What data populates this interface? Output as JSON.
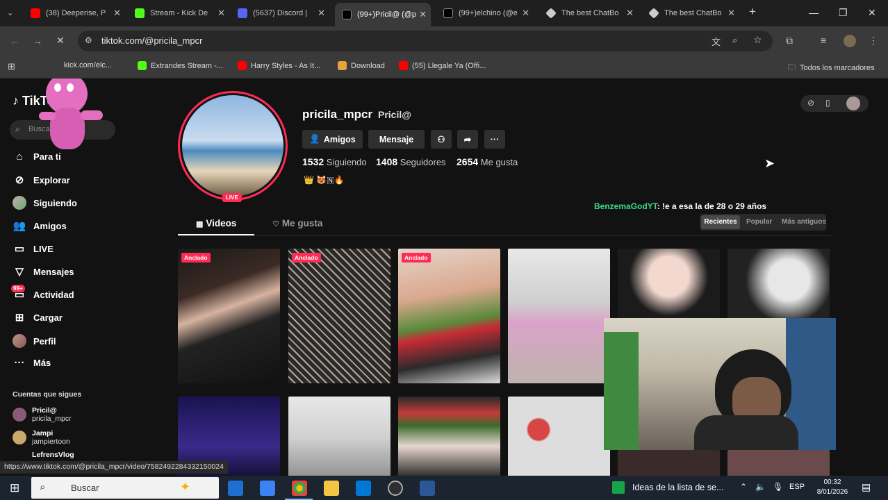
{
  "browser": {
    "tabs": [
      {
        "title": "(38) Deeperise, P",
        "color": "#ff0000"
      },
      {
        "title": "Stream - Kick De",
        "color": "#53fc18"
      },
      {
        "title": "(5637) Discord |",
        "color": "#5865f2"
      },
      {
        "title": "(99+)Pricil@ (@p",
        "color": "#000000"
      },
      {
        "title": "(99+)elchino (@e",
        "color": "#000000"
      },
      {
        "title": "The best ChatBo",
        "color": "#cccccc"
      },
      {
        "title": "The best ChatBo",
        "color": "#cccccc"
      }
    ],
    "new_tab_icon": "plus-icon",
    "url": "tiktok.com/@pricila_mpcr",
    "bookmarks": [
      {
        "label": "kick.com/elc...",
        "color": "#53fc18"
      },
      {
        "label": "Extrandes Stream -...",
        "color": "#53fc18"
      },
      {
        "label": "Harry Styles - As It...",
        "color": "#ff0000"
      },
      {
        "label": "Download",
        "color": "#e8a33d"
      },
      {
        "label": "(55) Llegale Ya (Offi...",
        "color": "#ff0000"
      }
    ],
    "all_bookmarks": "Todos los marcadores"
  },
  "sidebar": {
    "logo": "TikTok",
    "search_placeholder": "Buscar",
    "items": [
      {
        "label": "Para ti",
        "icon": "⌂"
      },
      {
        "label": "Explorar",
        "icon": "⊘"
      },
      {
        "label": "Siguiendo",
        "icon": "avatar"
      },
      {
        "label": "Amigos",
        "icon": "👥"
      },
      {
        "label": "LIVE",
        "icon": "▭"
      },
      {
        "label": "Mensajes",
        "icon": "▽"
      },
      {
        "label": "Actividad",
        "icon": "▭"
      },
      {
        "label": "Cargar",
        "icon": "⊞"
      },
      {
        "label": "Perfil",
        "icon": "avatar"
      },
      {
        "label": "Más",
        "icon": "···"
      }
    ],
    "activity_badge": "99+",
    "following_heading": "Cuentas que sigues",
    "following": [
      {
        "name": "Pricil@",
        "handle": "pricila_mpcr"
      },
      {
        "name": "Jampi",
        "handle": "jampiertoon"
      },
      {
        "name": "LefrensVlog",
        "handle": ""
      }
    ]
  },
  "profile": {
    "username": "pricila_mpcr",
    "nickname": "Pricil@",
    "live_badge": "LIVE",
    "buttons": {
      "friends": "Amigos",
      "message": "Mensaje"
    },
    "stats": [
      {
        "value": "1532",
        "label": "Siguiendo"
      },
      {
        "value": "1408",
        "label": "Seguidores"
      },
      {
        "value": "2654",
        "label": "Me gusta"
      }
    ],
    "bio": "👑 😻🇳🔥",
    "comment_user": "BenzemaGodYT",
    "comment_text": ": !e a esa la de 28 o 29 años",
    "tabs": [
      "Videos",
      "Me gusta"
    ],
    "sort": [
      "Recientes",
      "Popular",
      "Más antiguos"
    ],
    "pinned_label": "Anclado"
  },
  "status_url": "https://www.tiktok.com/@pricila_mpcr/video/7582492284332150024",
  "taskbar": {
    "search": "Buscar",
    "news": "Ideas de la lista de se...",
    "lang": "ESP",
    "time": "00:32",
    "date": "8/01/2026"
  }
}
